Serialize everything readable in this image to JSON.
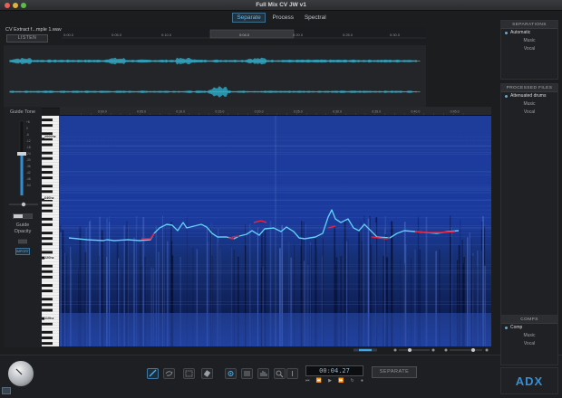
{
  "window": {
    "title": "Full Mix CV JW v1"
  },
  "mode_tabs": [
    {
      "label": "Separate",
      "active": true
    },
    {
      "label": "Process",
      "active": false
    },
    {
      "label": "Spectral",
      "active": false
    }
  ],
  "file": {
    "name": "CV Extract f...mple 1.wav",
    "listen_label": "LISTEN"
  },
  "overview_ruler": {
    "labels": [
      "0:00.0",
      "0:05.0",
      "0:10.0",
      "0:15.0",
      "0:20.0",
      "0:25.0",
      "0:30.0",
      "0:35.0",
      "0:40.0"
    ],
    "selection_label": "0:04.0"
  },
  "guide_panel": {
    "title": "Guide Tone",
    "opacity_label": "Guide\nOpacity",
    "import_label": "IMPORT",
    "scale_labels": [
      "+6",
      "0",
      "-6",
      "-12",
      "-18",
      "-24",
      "-30",
      "-36",
      "-42",
      "-48",
      "-54"
    ]
  },
  "piano_labels": [
    "2000hz",
    "640hz",
    "220hz",
    "110hz"
  ],
  "spectrogram_ruler": {
    "labels": [
      "0:00.0",
      "0:05.0",
      "0:10.0",
      "0:15.0",
      "0:20.0",
      "0:25.0",
      "0:30.0",
      "0:35.0",
      "0:40.0",
      "0:45.0"
    ]
  },
  "lcd": {
    "time": "00:04.27"
  },
  "separate_button": {
    "label": "SEPARATE"
  },
  "separations": {
    "header": "SEPARATIONS",
    "items": [
      "Automatic",
      "Music",
      "Vocal"
    ],
    "selected": "Automatic"
  },
  "processed": {
    "header": "PROCESSED FILES",
    "items": [
      "Attenuated drums",
      "Music",
      "Vocal"
    ],
    "selected": "Attenuated drums"
  },
  "comps": {
    "header": "COMPS",
    "items": [
      "Comp",
      "Music",
      "Vocal"
    ],
    "selected": "Comp"
  },
  "brand": {
    "logo_text": "ADX"
  },
  "colors": {
    "accent": "#4fb0e8",
    "spectrogram_bg": "#0d1d5a",
    "pitch_trace": "#49c3ef",
    "pitch_highlight": "#e8203c",
    "playhead": "#e0302a"
  }
}
